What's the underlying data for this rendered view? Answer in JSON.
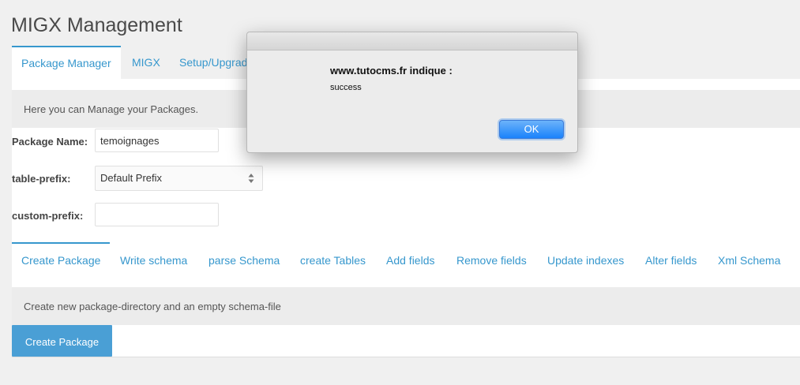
{
  "page": {
    "title": "MIGX Management"
  },
  "top_tabs": [
    {
      "label": "Package Manager",
      "active": true
    },
    {
      "label": "MIGX",
      "active": false
    },
    {
      "label": "Setup/Upgrad",
      "active": false
    }
  ],
  "info": {
    "text": "Here you can Manage your Packages."
  },
  "form": {
    "package_name_label": "Package Name:",
    "package_name_value": "temoignages",
    "table_prefix_label": "table-prefix:",
    "table_prefix_value": "Default Prefix",
    "custom_prefix_label": "custom-prefix:",
    "custom_prefix_value": ""
  },
  "sub_tabs": [
    {
      "label": "Create Package",
      "active": true
    },
    {
      "label": "Write schema",
      "active": false
    },
    {
      "label": "parse Schema",
      "active": false
    },
    {
      "label": "create Tables",
      "active": false
    },
    {
      "label": "Add fields",
      "active": false
    },
    {
      "label": "Remove fields",
      "active": false
    },
    {
      "label": "Update indexes",
      "active": false
    },
    {
      "label": "Alter fields",
      "active": false
    },
    {
      "label": "Xml Schema",
      "active": false
    }
  ],
  "sub_info": {
    "text": "Create new package-directory and an empty schema-file"
  },
  "create_button": {
    "label": "Create Package"
  },
  "dialog": {
    "title": "www.tutocms.fr indique :",
    "message": "success",
    "ok_label": "OK"
  },
  "colors": {
    "accent": "#3697cd",
    "button": "#4a9fd5",
    "ok_button": "#1a82fb"
  },
  "icons": {
    "select_arrows": "updown-arrows-icon"
  }
}
